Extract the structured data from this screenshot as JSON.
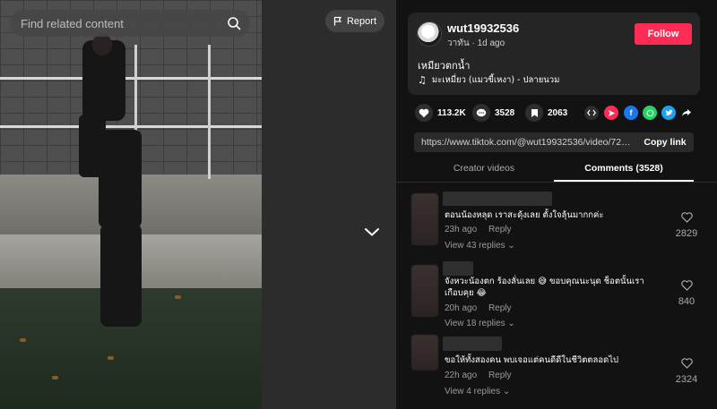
{
  "search": {
    "placeholder": "Find related content"
  },
  "report": {
    "label": "Report"
  },
  "author": {
    "username": "wut19932536",
    "display_name": "วาทัน",
    "posted": "1d ago",
    "follow_label": "Follow"
  },
  "post": {
    "caption": "เหมียวตกน้ำ",
    "music": "มะเหมี่ยว (แมวขี้เหงา) - ปลายนวม"
  },
  "actions": {
    "likes": "113.2K",
    "comments": "3528",
    "saves": "2063"
  },
  "share": {
    "embed_icon": "embed-icon",
    "send_icon": "send-icon",
    "facebook_icon": "facebook-icon",
    "whatsapp_icon": "whatsapp-icon",
    "twitter_icon": "twitter-icon",
    "more_icon": "share-arrow-icon"
  },
  "link": {
    "url": "https://www.tiktok.com/@wut19932536/video/72714...",
    "copy_label": "Copy link"
  },
  "tabs": {
    "creator_videos": "Creator videos",
    "comments": "Comments (3528)"
  },
  "comments": [
    {
      "text": "ตอนน้องหลุด เราสะดุ้งเลย ตั้งใจลุ้นมากกค่ะ",
      "time": "23h ago",
      "reply_label": "Reply",
      "view_replies": "View 43 replies",
      "likes": "2829"
    },
    {
      "text": "จังหวะน้องตก ร้องลั่นเลย 😅 ขอบคุณนะนุด ช็อตนั้นเราเกือบคุย 😂",
      "time": "20h ago",
      "reply_label": "Reply",
      "view_replies": "View 18 replies",
      "likes": "840"
    },
    {
      "text": "ขอให้ทั้งสองคน พบเจอแต่คนดีดีในชีวิตตลอดไป",
      "time": "22h ago",
      "reply_label": "Reply",
      "view_replies": "View 4 replies",
      "likes": "2324"
    }
  ],
  "colors": {
    "follow": "#fe2c55",
    "panel_bg": "#121212",
    "card_bg": "#252525",
    "muted_text": "#9a9a9a",
    "facebook": "#1877f2",
    "whatsapp": "#25d366",
    "twitter": "#1da1f2",
    "send": "#fe2c55"
  }
}
